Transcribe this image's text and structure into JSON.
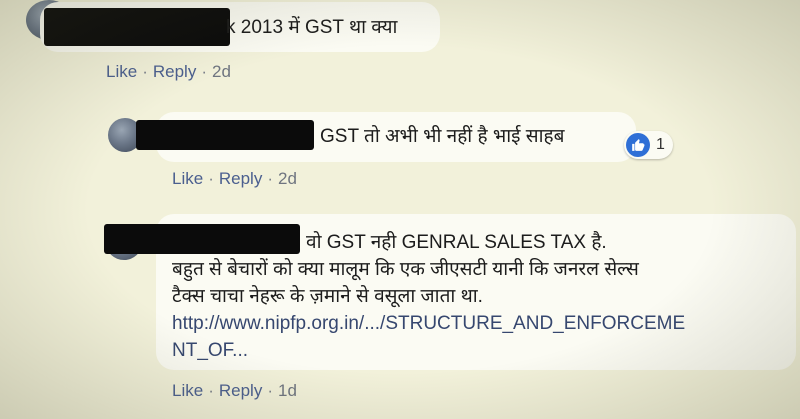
{
  "comments": [
    {
      "text_lines": [
        "k 2013 में GST था क्या"
      ],
      "actions": {
        "like": "Like",
        "reply": "Reply",
        "time": "2d"
      }
    },
    {
      "text_lines": [
        "GST तो अभी भी नहीं है भाई साहब"
      ],
      "reaction_count": "1",
      "actions": {
        "like": "Like",
        "reply": "Reply",
        "time": "2d"
      }
    },
    {
      "text_lines": [
        "वो GST नही GENRAL SALES TAX है.",
        "बहुत से बेचारों को क्या मालूम कि एक जीएसटी यानी कि जनरल सेल्स",
        "टैक्स चाचा नेहरू के ज़माने से वसूला जाता था."
      ],
      "link_lines": [
        "http://www.nipfp.org.in/.../STRUCTURE_AND_ENFORCEME",
        "NT_OF..."
      ],
      "actions": {
        "like": "Like",
        "reply": "Reply",
        "time": "1d"
      }
    }
  ],
  "sep": "·",
  "colors": {
    "background": "#f2f1da",
    "link": "#4b5f8f",
    "like_badge": "#2f6fd6"
  },
  "icons": {
    "reaction": "thumbs-up-icon"
  }
}
